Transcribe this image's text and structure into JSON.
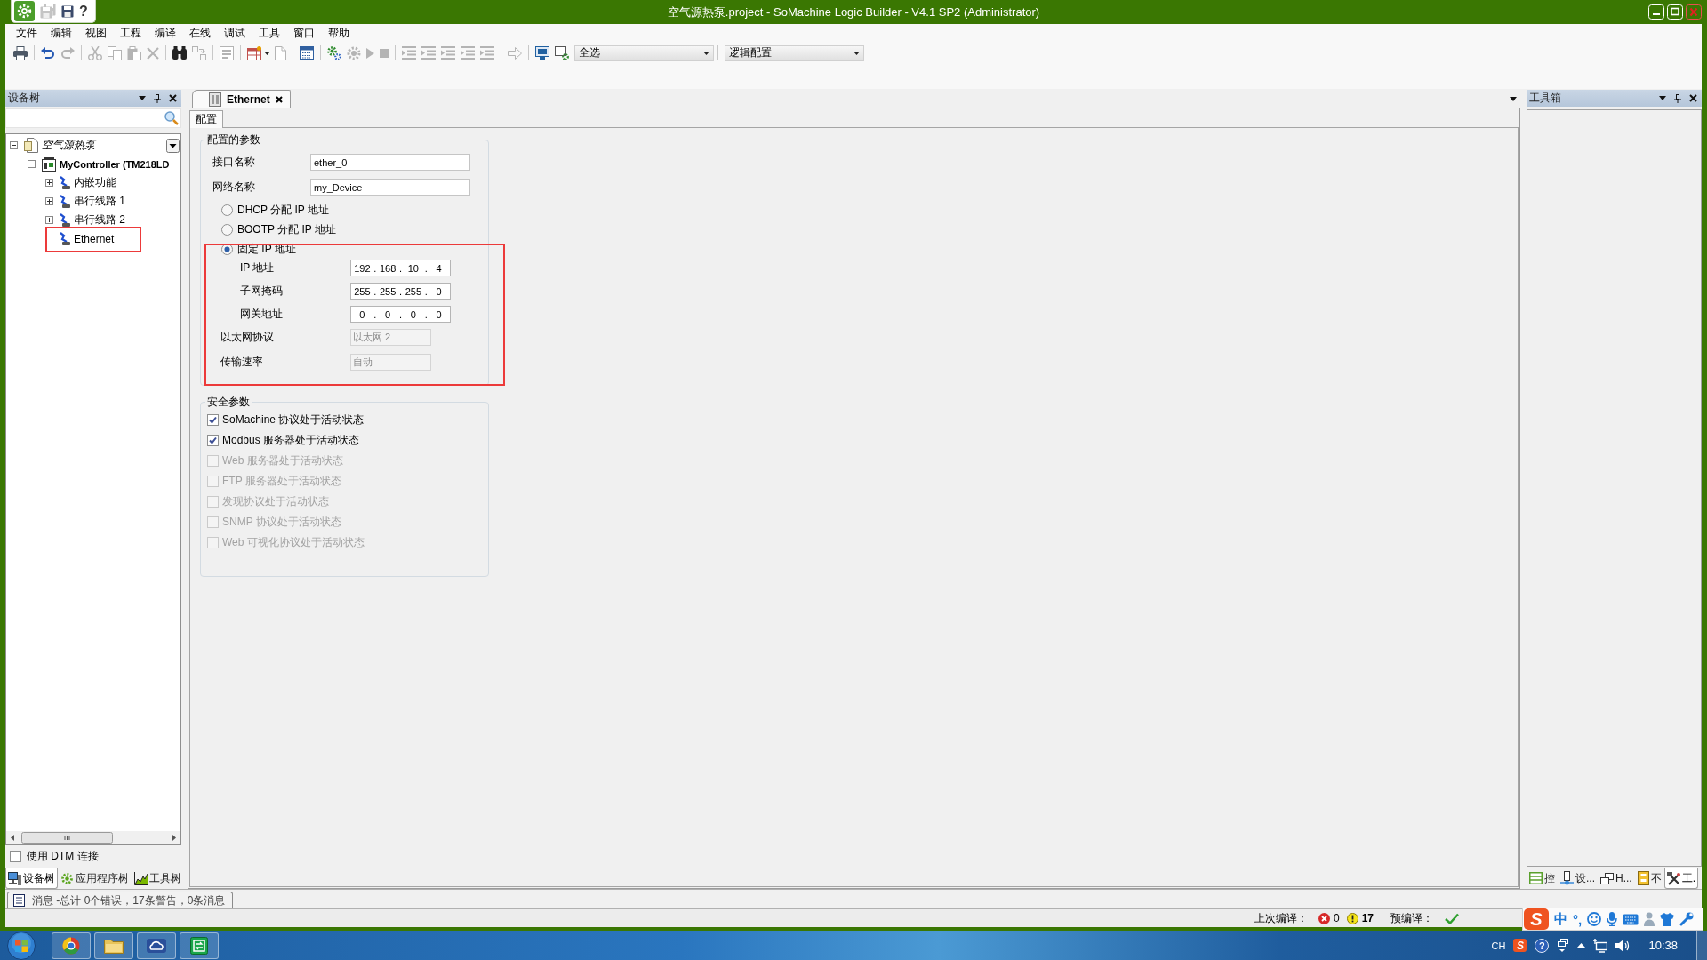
{
  "window": {
    "title": "空气源热泵.project - SoMachine Logic Builder - V4.1 SP2 (Administrator)"
  },
  "quick_access": [
    {
      "kind": "app",
      "disabled": false
    },
    {
      "kind": "save-all",
      "disabled": true
    },
    {
      "kind": "save",
      "disabled": false
    },
    {
      "kind": "help",
      "label": "?",
      "disabled": false
    }
  ],
  "menu": [
    "文件",
    "编辑",
    "视图",
    "工程",
    "编译",
    "在线",
    "调试",
    "工具",
    "窗口",
    "帮助"
  ],
  "toolbar": {
    "groups": [
      {
        "items": [
          {
            "kind": "print",
            "disabled": false
          }
        ]
      },
      {
        "items": [
          {
            "kind": "undo",
            "disabled": false
          },
          {
            "kind": "redo",
            "disabled": true
          }
        ]
      },
      {
        "items": [
          {
            "kind": "cut",
            "disabled": true
          },
          {
            "kind": "copy",
            "disabled": true
          },
          {
            "kind": "paste",
            "disabled": true
          },
          {
            "kind": "delete",
            "disabled": true
          }
        ]
      },
      {
        "items": [
          {
            "kind": "find",
            "disabled": false
          },
          {
            "kind": "replace",
            "disabled": true
          }
        ]
      },
      {
        "items": [
          {
            "kind": "page",
            "disabled": true
          }
        ]
      },
      {
        "items": [
          {
            "kind": "insert",
            "disabled": false
          },
          {
            "kind": "caret",
            "disabled": false
          },
          {
            "kind": "doc",
            "disabled": true
          }
        ]
      },
      {
        "items": [
          {
            "kind": "calendar",
            "disabled": false
          }
        ]
      },
      {
        "items": [
          {
            "kind": "build",
            "disabled": false
          },
          {
            "kind": "gear",
            "disabled": true
          },
          {
            "kind": "play",
            "disabled": true
          },
          {
            "kind": "stop",
            "disabled": true
          }
        ]
      },
      {
        "items": [
          {
            "kind": "list",
            "disabled": true
          },
          {
            "kind": "list",
            "disabled": true
          },
          {
            "kind": "list",
            "disabled": true
          },
          {
            "kind": "list",
            "disabled": true
          },
          {
            "kind": "list",
            "disabled": true
          }
        ]
      },
      {
        "items": [
          {
            "kind": "arrow",
            "disabled": true
          }
        ]
      },
      {
        "items": [
          {
            "kind": "monitor",
            "disabled": false
          },
          {
            "kind": "monitor-gear",
            "disabled": false
          },
          {
            "kind": "dropdown",
            "value": "全选",
            "disabled": false
          }
        ]
      },
      {
        "items": [
          {
            "kind": "dropdown",
            "value": "逻辑配置",
            "disabled": false
          }
        ]
      }
    ]
  },
  "device_tree": {
    "title": "设备树",
    "items": [
      {
        "kind": "project",
        "label": "空气源热泵",
        "expanded": true,
        "highlighted": false,
        "children": [
          {
            "kind": "controller",
            "label": "MyController (TM218LD",
            "expanded": true,
            "highlighted": false,
            "children": [
              {
                "kind": "connector",
                "label": "内嵌功能",
                "expanded": false,
                "highlighted": false
              },
              {
                "kind": "connector",
                "label": "串行线路 1",
                "expanded": false,
                "highlighted": false
              },
              {
                "kind": "connector",
                "label": "串行线路 2",
                "expanded": false,
                "highlighted": false
              },
              {
                "kind": "connector",
                "label": "Ethernet",
                "highlighted": true
              }
            ]
          }
        ]
      }
    ],
    "use_dtm": {
      "label": "使用 DTM 连接",
      "checked": false
    },
    "tabs": [
      {
        "kind": "devices",
        "label": "设备树",
        "selected": true
      },
      {
        "kind": "applications",
        "label": "应用程序树",
        "selected": false
      },
      {
        "kind": "tools",
        "label": "工具树",
        "selected": false
      }
    ]
  },
  "editor": {
    "tabs": [
      {
        "label": "Ethernet",
        "selected": true
      }
    ],
    "pages": [
      {
        "label": "配置",
        "selected": true
      }
    ],
    "config": {
      "title": "配置的参数",
      "fields": [
        {
          "label": "接口名称",
          "value": "ether_0"
        },
        {
          "label": "网络名称",
          "value": "my_Device"
        }
      ],
      "ip_modes": [
        {
          "label": "DHCP 分配 IP 地址",
          "selected": false
        },
        {
          "label": "BOOTP 分配 IP 地址",
          "selected": false
        },
        {
          "label": "固定 IP 地址",
          "selected": true
        }
      ],
      "fixed_ip": {
        "highlighted": true,
        "addresses": [
          {
            "label": "IP 地址",
            "parts": [
              "192",
              ".",
              "168",
              ".",
              "10",
              ".",
              "4"
            ]
          },
          {
            "label": "子网掩码",
            "parts": [
              "255",
              ".",
              "255",
              ".",
              "255",
              ".",
              "0"
            ]
          },
          {
            "label": "网关地址",
            "parts": [
              "0",
              ".",
              "0",
              ".",
              "0",
              ".",
              "0"
            ]
          }
        ],
        "settings": [
          {
            "label": "以太网协议",
            "value": "以太网 2",
            "disabled": true
          },
          {
            "label": "传输速率",
            "value": "自动",
            "disabled": true
          }
        ]
      }
    },
    "security": {
      "title": "安全参数",
      "options": [
        {
          "label": "SoMachine 协议处于活动状态",
          "checked": true,
          "disabled": false
        },
        {
          "label": "Modbus 服务器处于活动状态",
          "checked": true,
          "disabled": false
        },
        {
          "label": "Web 服务器处于活动状态",
          "checked": false,
          "disabled": true
        },
        {
          "label": "FTP 服务器处于活动状态",
          "checked": false,
          "disabled": true
        },
        {
          "label": "发现协议处于活动状态",
          "checked": false,
          "disabled": true
        },
        {
          "label": "SNMP 协议处于活动状态",
          "checked": false,
          "disabled": true
        },
        {
          "label": "Web 可视化协议处于活动状态",
          "checked": false,
          "disabled": true
        }
      ]
    }
  },
  "toolbox": {
    "title": "工具箱",
    "tabs": [
      {
        "kind": "controls",
        "label": "控",
        "selected": false
      },
      {
        "kind": "devices",
        "label": "设...",
        "selected": false
      },
      {
        "kind": "windows",
        "label": "H...",
        "selected": false
      },
      {
        "kind": "library",
        "label": "不",
        "selected": false
      },
      {
        "kind": "tools",
        "label": "工.",
        "selected": true
      }
    ]
  },
  "messages": {
    "label": "消息 -总计 0个错误，17条警告，0条消息"
  },
  "status_bar": {
    "last_build_label": "上次编译：",
    "errors": "0",
    "warnings": "17",
    "precompile_label": "预编译：",
    "precompile_ok": true
  },
  "ime_bar": {
    "logo": "S",
    "mode": "中",
    "punctuation": "°,"
  },
  "taskbar": {
    "apps": [
      {
        "kind": "browser"
      },
      {
        "kind": "folder"
      },
      {
        "kind": "cloud"
      },
      {
        "kind": "network-app"
      }
    ],
    "tray": {
      "language": "CH",
      "ime_logo": "S",
      "help": "?",
      "time": "10:38"
    }
  }
}
